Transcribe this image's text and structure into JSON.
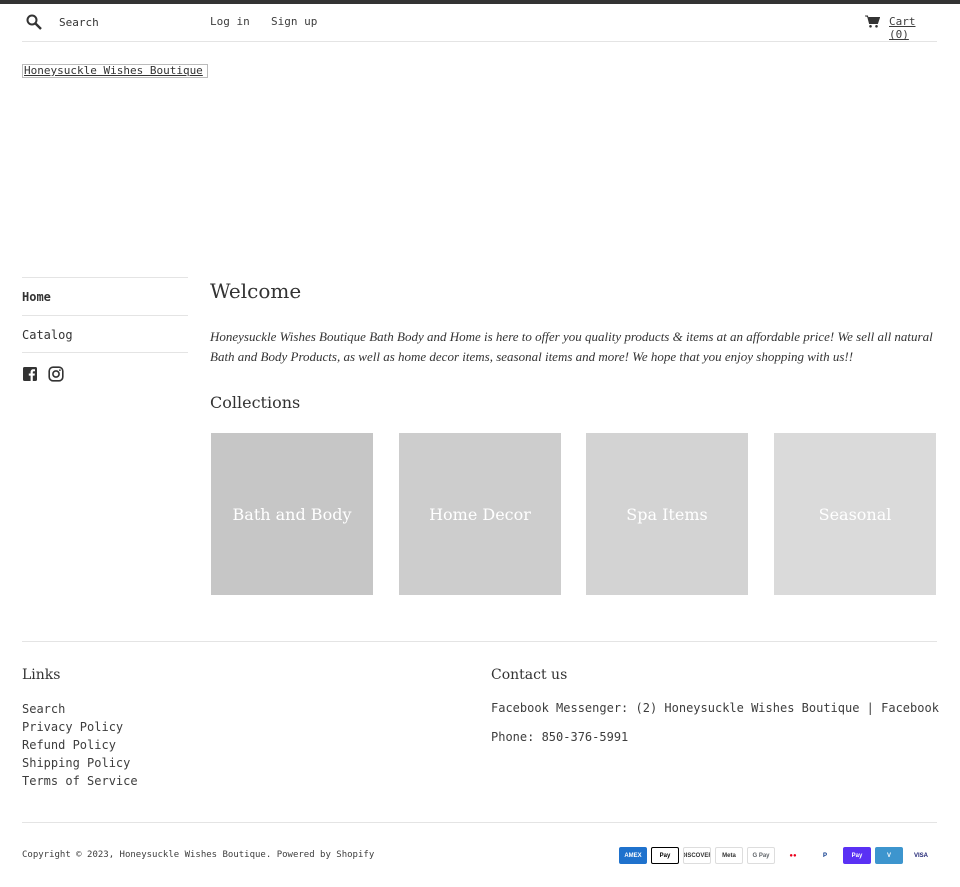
{
  "header": {
    "search_placeholder": "Search",
    "login_label": "Log in",
    "signup_label": "Sign up",
    "cart_label": "Cart (0)"
  },
  "logo": {
    "text": "Honeysuckle Wishes Boutique"
  },
  "sidebar": {
    "items": [
      {
        "label": "Home"
      },
      {
        "label": "Catalog"
      }
    ],
    "social_icons": [
      "facebook-icon",
      "instagram-icon"
    ]
  },
  "main": {
    "title": "Welcome",
    "intro": "Honeysuckle Wishes Boutique Bath Body and Home is here to offer you quality products & items at an affordable price! We sell all natural Bath and Body Products, as well as home decor items, seasonal items and more! We hope that you enjoy shopping with us!!",
    "collections_title": "Collections",
    "collections": [
      {
        "label": "Bath and Body",
        "color": "#c6c6c6"
      },
      {
        "label": "Home Decor",
        "color": "#cdcdcd"
      },
      {
        "label": "Spa Items",
        "color": "#d3d3d3"
      },
      {
        "label": "Seasonal",
        "color": "#dadada"
      }
    ]
  },
  "footer": {
    "links_title": "Links",
    "links": [
      "Search",
      "Privacy Policy",
      "Refund Policy",
      "Shipping Policy",
      "Terms of Service"
    ],
    "contact_title": "Contact us",
    "contact_messenger": "Facebook Messenger: (2) Honeysuckle Wishes Boutique | Facebook",
    "contact_phone": "Phone: 850-376-5991",
    "copyright_prefix": "Copyright © 2023,",
    "copyright_store": "Honeysuckle Wishes Boutique",
    "powered_by": "Powered by Shopify",
    "payment_methods": [
      {
        "label": "AMEX",
        "bg": "#1f72cd",
        "fg": "#ffffff",
        "border": "#1f72cd"
      },
      {
        "label": "Pay",
        "bg": "#ffffff",
        "fg": "#000000",
        "border": "#000000"
      },
      {
        "label": "DISCOVER",
        "bg": "#ffffff",
        "fg": "#333333",
        "border": "#dddddd"
      },
      {
        "label": "Meta",
        "bg": "#ffffff",
        "fg": "#333333",
        "border": "#dddddd"
      },
      {
        "label": "G Pay",
        "bg": "#ffffff",
        "fg": "#5f6368",
        "border": "#dddddd"
      },
      {
        "label": "●●",
        "bg": "#ffffff",
        "fg": "#eb001b",
        "border": "#ffffff"
      },
      {
        "label": "P",
        "bg": "#ffffff",
        "fg": "#003087",
        "border": "#ffffff"
      },
      {
        "label": "Pay",
        "bg": "#5a31f4",
        "fg": "#ffffff",
        "border": "#5a31f4"
      },
      {
        "label": "V",
        "bg": "#3d95ce",
        "fg": "#ffffff",
        "border": "#3d95ce"
      },
      {
        "label": "VISA",
        "bg": "#ffffff",
        "fg": "#1a1f71",
        "border": "#ffffff"
      }
    ]
  }
}
